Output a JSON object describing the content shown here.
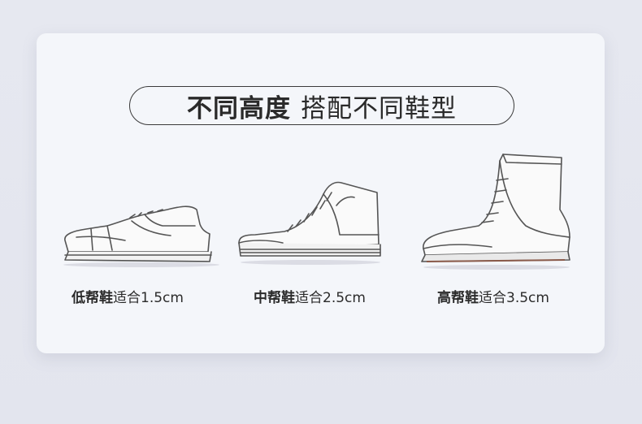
{
  "title": {
    "part1": "不同高度",
    "part2": "搭配不同鞋型"
  },
  "items": [
    {
      "bold": "低帮鞋",
      "text": "适合1.5cm",
      "icon": "low-top-sneaker"
    },
    {
      "bold": "中帮鞋",
      "text": "适合2.5cm",
      "icon": "mid-top-canvas-shoe"
    },
    {
      "bold": "高帮鞋",
      "text": "适合3.5cm",
      "icon": "high-top-boot"
    }
  ]
}
